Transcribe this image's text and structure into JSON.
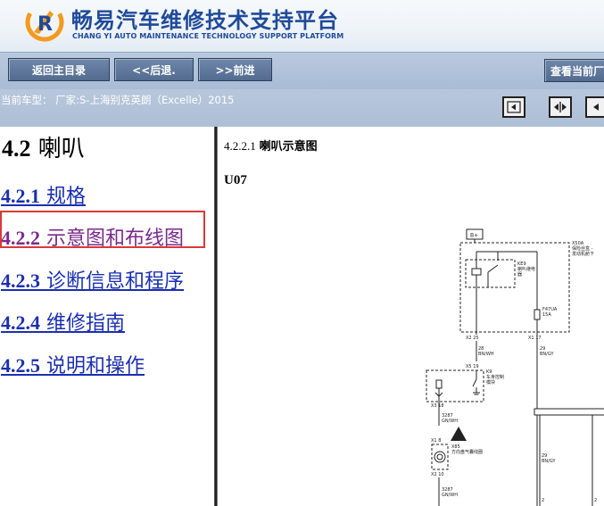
{
  "header": {
    "title": "畅易汽车维修技术支持平台",
    "subtitle": "CHANG YI AUTO MAINTENANCE TECHNOLOGY SUPPORT PLATFORM"
  },
  "toolbar": {
    "home_label": "返回主目录",
    "back_label": "<<后退.",
    "forward_label": ">>前进",
    "view_label": "查看当前厂"
  },
  "vehicle": {
    "label": "当前车型：  厂家:S-上海别克英朗（Excelle）2015"
  },
  "nav": {
    "section_num": "4.2",
    "section_title": "喇叭",
    "items": [
      {
        "num": "4.2.1",
        "label": "规格"
      },
      {
        "num": "4.2.2",
        "label": "示意图和布线图"
      },
      {
        "num": "4.2.3",
        "label": "诊断信息和程序"
      },
      {
        "num": "4.2.4",
        "label": "维修指南"
      },
      {
        "num": "4.2.5",
        "label": "说明和操作"
      }
    ]
  },
  "content": {
    "sub_num": "4.2.2.1",
    "sub_title": "喇叭示意图",
    "figure_code": "U07",
    "diagram": {
      "battery": "B+",
      "fusebox_id": "X50A",
      "fusebox_desc_1": "保险丝盒 -",
      "fusebox_desc_2": "发动机舱下",
      "relay_id": "KE9",
      "relay_desc_1": "喇叭继电",
      "relay_desc_2": "器",
      "fuse_id": "F47UA",
      "fuse_rating": "15A",
      "pin_x2_25": "X2  25",
      "pin_x1_17": "X1  17",
      "wire_28": "28",
      "wire_28_color": "BN/WH",
      "wire_29": "29",
      "wire_29_color": "BN/GY",
      "pin_x5_19": "X5  19",
      "bcm_id": "K9",
      "bcm_desc_1": "车身控制",
      "bcm_desc_2": "模块",
      "pin_x3_18": "X3  18",
      "wire_3287": "3287",
      "wire_3287_color": "GN/WH",
      "pin_x1_8": "X1  8",
      "clock_id": "X85",
      "clock_desc": "方向盘气囊线圈",
      "pin_x2_10": "X2  10",
      "wire_29b": "29",
      "wire_29b_color": "BN/GY",
      "wire_3287b": "3287",
      "wire_3287b_color": "GN/WH",
      "pin_2a": "2",
      "pin_2b": "2"
    }
  }
}
